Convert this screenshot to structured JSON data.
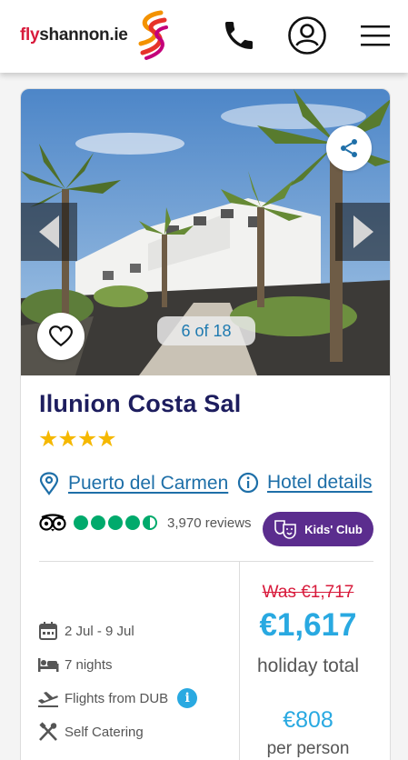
{
  "header": {
    "logo_prefix": "fly",
    "logo_rest": "shannon.ie",
    "phone_icon": "phone-icon",
    "account_icon": "account-icon",
    "menu_icon": "menu-icon"
  },
  "gallery": {
    "counter": "6 of 18",
    "prev_icon": "chevron-left-icon",
    "next_icon": "chevron-right-icon",
    "share_icon": "share-icon",
    "favourite_icon": "heart-icon"
  },
  "hotel": {
    "name": "Ilunion Costa Sal",
    "stars": "★★★★",
    "star_rating": 4,
    "location": "Puerto del Carmen",
    "details_link": "Hotel details",
    "reviews_count": "3,970 reviews",
    "review_score": 4.5,
    "badge": "Kids' Club"
  },
  "info": {
    "dates": "2 Jul - 9 Jul",
    "nights": "7 nights",
    "flights": "Flights from DUB",
    "board": "Self Catering"
  },
  "price": {
    "was": "Was €1,717",
    "total": "€1,617",
    "total_label": "holiday total",
    "per_person": "€808",
    "per_person_label": "per person"
  },
  "colors": {
    "brand_red": "#d81b3c",
    "navy": "#1d1d5e",
    "link_blue": "#1e6fa8",
    "price_blue": "#29a9e1",
    "star_gold": "#f5b800",
    "tripadvisor_green": "#00aa6c",
    "badge_purple": "#5b2d8e"
  }
}
